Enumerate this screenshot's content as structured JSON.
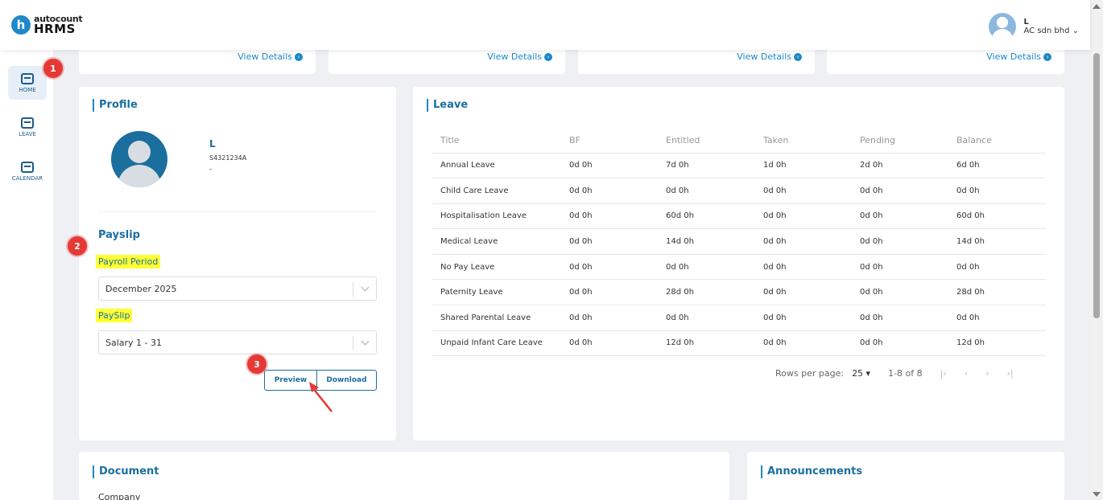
{
  "header": {
    "logo_top": "autocount",
    "logo_bottom": "HRMS",
    "logo_letter": "h",
    "user_name": "L",
    "company": "AC sdn bhd ⌄"
  },
  "sidebar": {
    "items": [
      {
        "label": "HOME",
        "icon": "home-icon",
        "active": true
      },
      {
        "label": "LEAVE",
        "icon": "leave-icon",
        "active": false
      },
      {
        "label": "CALENDAR",
        "icon": "calendar-icon",
        "active": false
      }
    ]
  },
  "badges": [
    "1",
    "2",
    "3"
  ],
  "top_cards": {
    "view_details": "View Details"
  },
  "profile": {
    "title": "Profile",
    "name": "L",
    "id": "S4321234A",
    "extra": "-"
  },
  "payslip": {
    "title": "Payslip",
    "period_label": "Payroll Period",
    "period_value": "December 2025",
    "payslip_label": "PaySlip",
    "payslip_value": "Salary 1 - 31",
    "preview_label": "Preview",
    "download_label": "Download"
  },
  "leave": {
    "title": "Leave",
    "headers": [
      "Title",
      "BF",
      "Entitled",
      "Taken",
      "Pending",
      "Balance"
    ],
    "rows": [
      [
        "Annual Leave",
        "0d 0h",
        "7d 0h",
        "1d 0h",
        "2d 0h",
        "6d 0h"
      ],
      [
        "Child Care Leave",
        "0d 0h",
        "0d 0h",
        "0d 0h",
        "0d 0h",
        "0d 0h"
      ],
      [
        "Hospitalisation Leave",
        "0d 0h",
        "60d 0h",
        "0d 0h",
        "0d 0h",
        "60d 0h"
      ],
      [
        "Medical Leave",
        "0d 0h",
        "14d 0h",
        "0d 0h",
        "0d 0h",
        "14d 0h"
      ],
      [
        "No Pay Leave",
        "0d 0h",
        "0d 0h",
        "0d 0h",
        "0d 0h",
        "0d 0h"
      ],
      [
        "Paternity Leave",
        "0d 0h",
        "28d 0h",
        "0d 0h",
        "0d 0h",
        "28d 0h"
      ],
      [
        "Shared Parental Leave",
        "0d 0h",
        "0d 0h",
        "0d 0h",
        "0d 0h",
        "0d 0h"
      ],
      [
        "Unpaid Infant Care Leave",
        "0d 0h",
        "12d 0h",
        "0d 0h",
        "0d 0h",
        "12d 0h"
      ]
    ],
    "rows_per_page_label": "Rows per page:",
    "rows_per_page_value": "25 ▾",
    "range": "1-8 of 8",
    "nav": [
      "|‹",
      "‹",
      "›",
      "›|"
    ]
  },
  "document": {
    "title": "Document",
    "first_item": "Company"
  },
  "announcements": {
    "title": "Announcements"
  },
  "colors": {
    "accent": "#1e88c8",
    "title": "#1a6f9f",
    "badge": "#e53935",
    "highlight": "#ffff33"
  }
}
